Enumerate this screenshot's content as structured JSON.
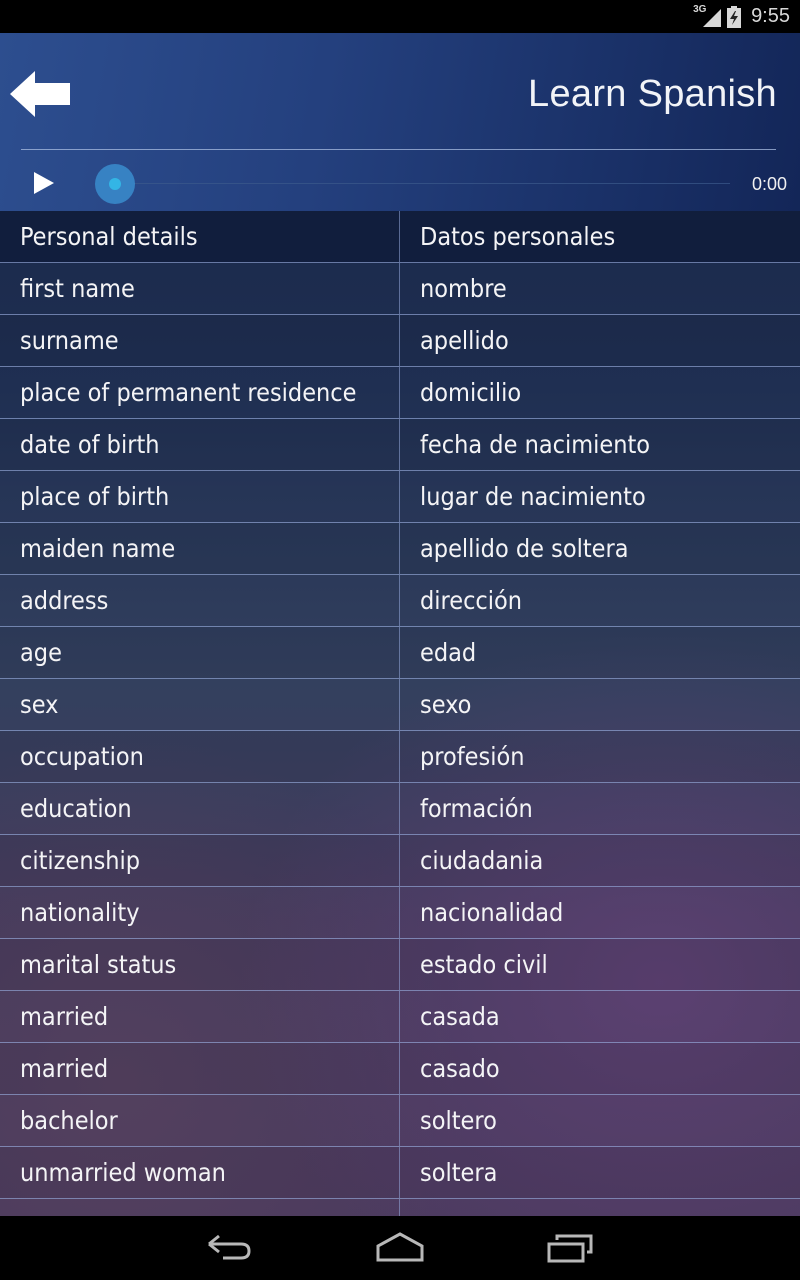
{
  "status_bar": {
    "network_label": "3G",
    "time": "9:55"
  },
  "header": {
    "title": "Learn Spanish",
    "back_icon": "back-arrow-icon"
  },
  "player": {
    "play_icon": "play-icon",
    "progress": 0,
    "duration": "0:00"
  },
  "table": {
    "header": {
      "en": "Personal details",
      "es": "Datos personales"
    },
    "rows": [
      {
        "en": "first name",
        "es": "nombre"
      },
      {
        "en": "surname",
        "es": "apellido"
      },
      {
        "en": "place of permanent residence",
        "es": "domicilio"
      },
      {
        "en": "date of birth",
        "es": "fecha de nacimiento"
      },
      {
        "en": "place of birth",
        "es": "lugar de nacimiento"
      },
      {
        "en": "maiden name",
        "es": "apellido de soltera"
      },
      {
        "en": "address",
        "es": "dirección"
      },
      {
        "en": "age",
        "es": "edad"
      },
      {
        "en": "sex",
        "es": "sexo"
      },
      {
        "en": "occupation",
        "es": "profesión"
      },
      {
        "en": "education",
        "es": "formación"
      },
      {
        "en": "citizenship",
        "es": "ciudadania"
      },
      {
        "en": "nationality",
        "es": "nacionalidad"
      },
      {
        "en": "marital status",
        "es": "estado civil"
      },
      {
        "en": "married",
        "es": "casada"
      },
      {
        "en": "married",
        "es": "casado"
      },
      {
        "en": "bachelor",
        "es": "soltero"
      },
      {
        "en": "unmarried woman",
        "es": "soltera"
      }
    ]
  },
  "nav_bar": {
    "back_icon": "nav-back-icon",
    "home_icon": "nav-home-icon",
    "recents_icon": "nav-recents-icon"
  },
  "colors": {
    "accent": "#33b5e5",
    "header_bg": "#24407e"
  }
}
